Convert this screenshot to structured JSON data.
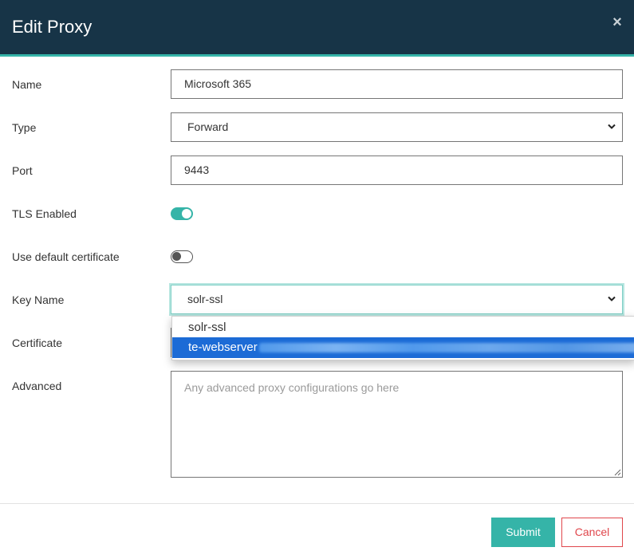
{
  "dialog": {
    "title": "Edit Proxy",
    "close_icon": "close-icon"
  },
  "form": {
    "name": {
      "label": "Name",
      "value": "Microsoft 365"
    },
    "type": {
      "label": "Type",
      "value": "Forward"
    },
    "port": {
      "label": "Port",
      "value": "9443"
    },
    "tls_enabled": {
      "label": "TLS Enabled",
      "checked": true
    },
    "use_default_certificate": {
      "label": "Use default certificate",
      "checked": false
    },
    "key_name": {
      "label": "Key Name",
      "value": "solr-ssl",
      "options": [
        "solr-ssl",
        "te-webserver"
      ],
      "highlighted_option": "te-webserver"
    },
    "certificate": {
      "label": "Certificate"
    },
    "advanced": {
      "label": "Advanced",
      "placeholder": "Any advanced proxy configurations go here"
    }
  },
  "footer": {
    "submit_label": "Submit",
    "cancel_label": "Cancel"
  },
  "colors": {
    "header_bg": "#173447",
    "accent": "#35b4a8",
    "cancel": "#e0474c",
    "selection": "#1c6bd6"
  }
}
